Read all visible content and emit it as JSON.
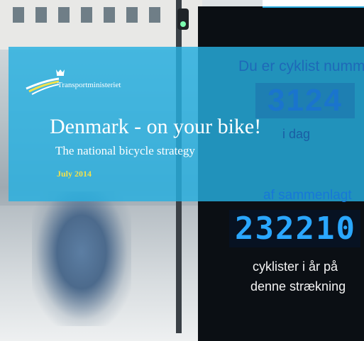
{
  "cover": {
    "ministry": "Transportministeriet",
    "title": "Denmark - on your bike!",
    "subtitle": "The national bicycle strategy",
    "date": "July 2014"
  },
  "display_sign": {
    "line1": "Du er cyklist nummer",
    "today_count": "3124",
    "line2": "i dag",
    "line3": "af sammenlagt",
    "total_count": "232210",
    "line4": "cyklister i år på",
    "line5": "denne strækning"
  },
  "colors": {
    "overlay": "#26b0e0",
    "date": "#f2e14b",
    "display": "#0b0f14"
  }
}
